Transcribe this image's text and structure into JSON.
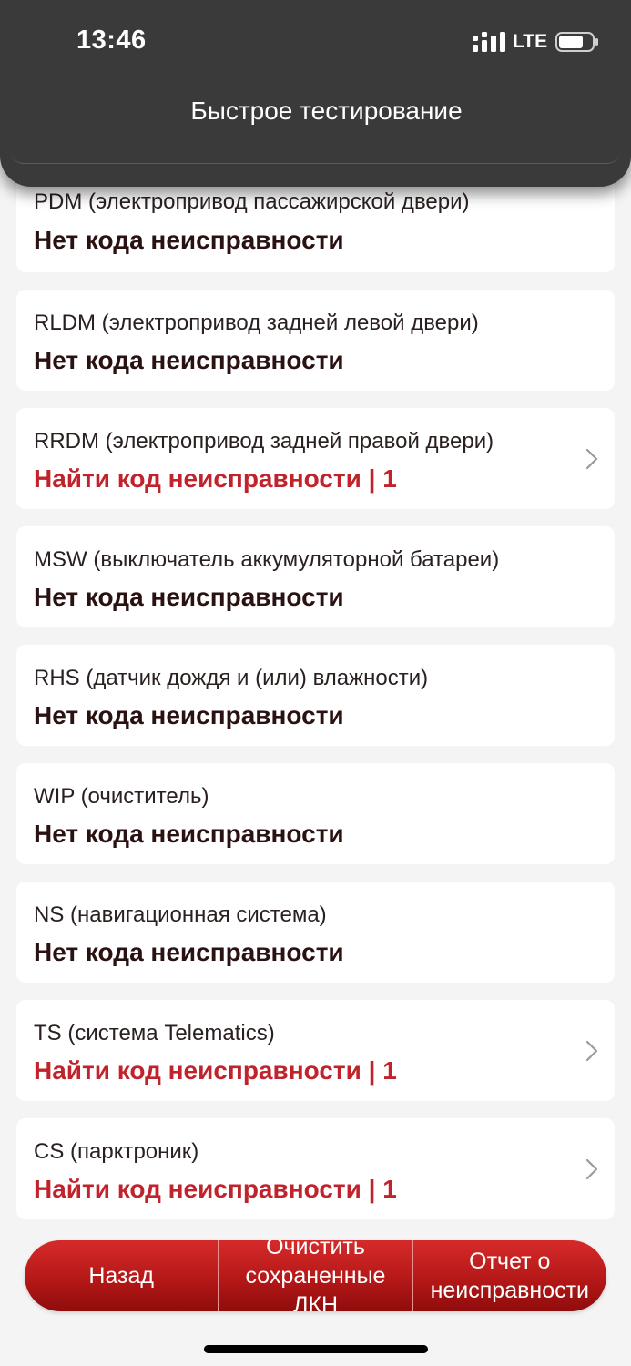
{
  "status_bar": {
    "time": "13:46",
    "network": "LTE"
  },
  "header": {
    "title": "Быстрое тестирование"
  },
  "items": [
    {
      "title": "PDM (электропривод пассажирской двери)",
      "status": "Нет кода неисправности",
      "fault": false
    },
    {
      "title": "RLDM (электропривод задней левой двери)",
      "status": "Нет кода неисправности",
      "fault": false
    },
    {
      "title": "RRDM (электропривод задней правой двери)",
      "status": "Найти код неисправности | 1",
      "fault": true
    },
    {
      "title": "MSW (выключатель аккумуляторной батареи)",
      "status": "Нет кода неисправности",
      "fault": false
    },
    {
      "title": "RHS (датчик дождя и (или) влажности)",
      "status": "Нет кода неисправности",
      "fault": false
    },
    {
      "title": "WIP (очиститель)",
      "status": "Нет кода неисправности",
      "fault": false
    },
    {
      "title": "NS (навигационная система)",
      "status": "Нет кода неисправности",
      "fault": false
    },
    {
      "title": "TS (система Telematics)",
      "status": "Найти код неисправности | 1",
      "fault": true
    },
    {
      "title": "CS (парктроник)",
      "status": "Найти код неисправности | 1",
      "fault": true
    }
  ],
  "footer": {
    "back_label": "Назад",
    "clear_label": "Очистить сохраненные ЛКН",
    "report_label": "Отчет о неисправности"
  },
  "colors": {
    "fault": "#c0232c",
    "ok": "#2a1212",
    "accent": "#b51818",
    "header_bg": "#3a3a3a"
  }
}
